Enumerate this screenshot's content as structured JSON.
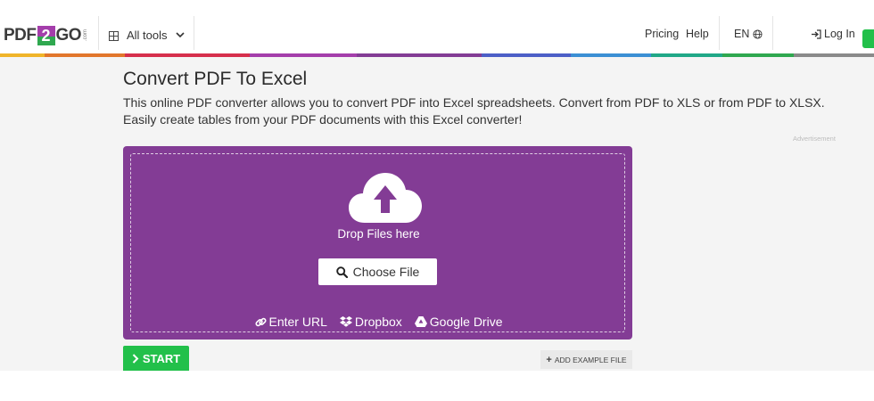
{
  "header": {
    "logo": {
      "left": "PDF",
      "middle": "2",
      "right": "GO",
      "suffix": ".com"
    },
    "all_tools_label": "All tools",
    "nav": {
      "pricing": "Pricing",
      "help": "Help",
      "language": "EN",
      "login": "Log In"
    }
  },
  "colors": {
    "brand_purple": "#833c95",
    "start_green": "#22c04a",
    "stripe": [
      "#f0b429",
      "#e2762b",
      "#d62f4c",
      "#a43eab",
      "#833c95",
      "#4c5fc7",
      "#3b8fd4",
      "#20a887",
      "#2fa84f",
      "#8a8a8a"
    ]
  },
  "main": {
    "title": "Convert PDF To Excel",
    "description": "This online PDF converter allows you to convert PDF into Excel spreadsheets. Convert from PDF to XLS or from PDF to XLSX. Easily create tables from your PDF documents with this Excel converter!",
    "advertisement": "Advertisement"
  },
  "upload": {
    "icon": "cloud-upload-icon",
    "drop_text": "Drop Files here",
    "choose_label": "Choose File",
    "sources": [
      {
        "icon": "link-icon",
        "label": "Enter URL"
      },
      {
        "icon": "dropbox-icon",
        "label": "Dropbox"
      },
      {
        "icon": "google-drive-icon",
        "label": "Google Drive"
      }
    ]
  },
  "actions": {
    "start_label": "START",
    "example_label": "ADD EXAMPLE FILE"
  }
}
